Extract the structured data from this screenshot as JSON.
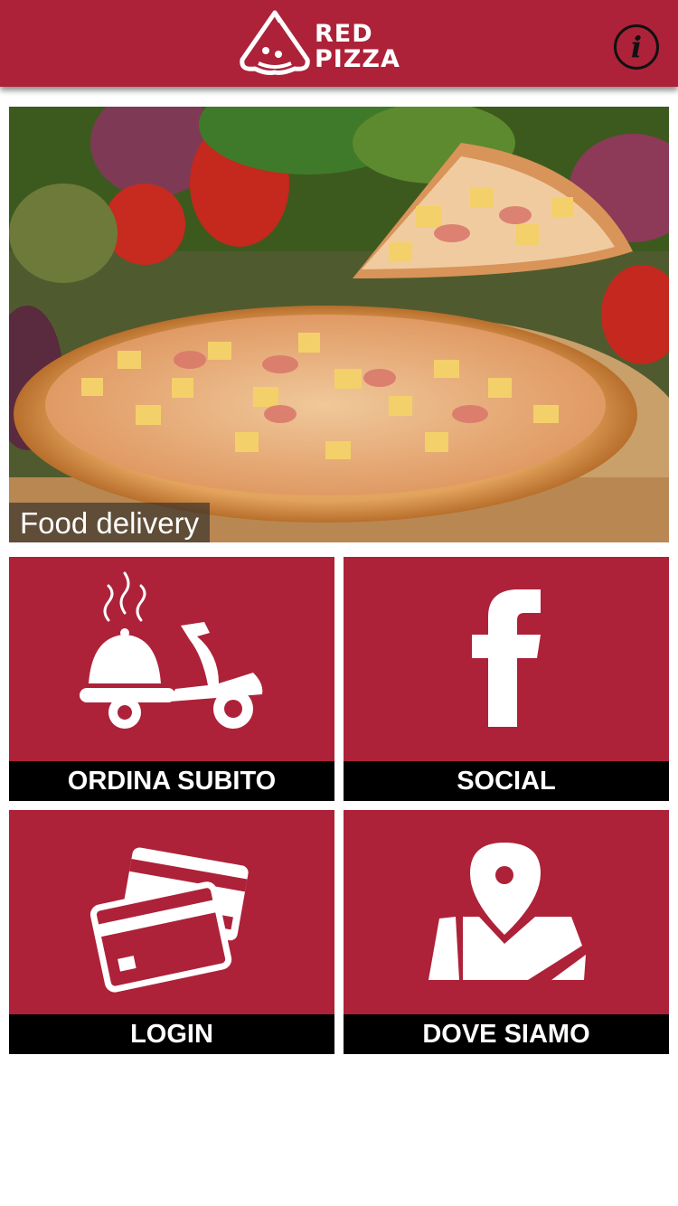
{
  "header": {
    "logo_line1": "RED",
    "logo_line2": "PIZZA",
    "info_icon": "info-icon",
    "info_label": "i"
  },
  "hero": {
    "caption": "Food delivery",
    "image": "pizza-photo"
  },
  "tiles": [
    {
      "label": "ORDINA SUBITO",
      "icon": "scooter-delivery-icon"
    },
    {
      "label": "SOCIAL",
      "icon": "facebook-icon"
    },
    {
      "label": "LOGIN",
      "icon": "credit-cards-icon"
    },
    {
      "label": "DOVE SIAMO",
      "icon": "map-pin-icon"
    }
  ],
  "colors": {
    "brand_red": "#ad2239",
    "label_bar": "#000000",
    "text_light": "#ffffff"
  }
}
